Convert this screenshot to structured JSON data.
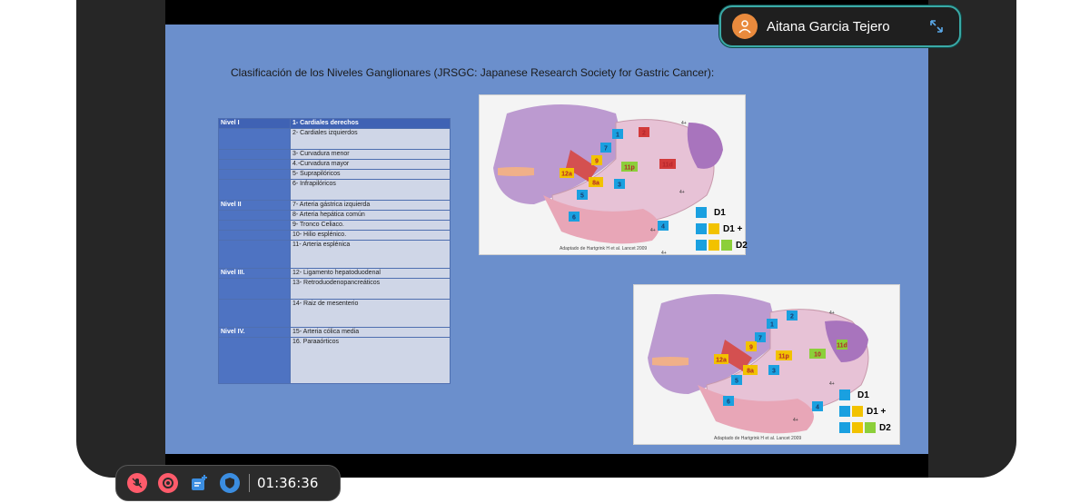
{
  "participant": {
    "name": "Aitana Garcia Tejero"
  },
  "toolbar": {
    "timer": "01:36:36"
  },
  "slide": {
    "title": "Clasificación de los Niveles Ganglionares (JRSGC: Japanese Research Society for Gastric Cancer):",
    "table": [
      {
        "level": "Nivel I",
        "desc": "1- Cardiales derechos",
        "header": true
      },
      {
        "level": "",
        "desc": "2- Cardiales izquierdos",
        "tall": true
      },
      {
        "level": "",
        "desc": "3- Curvadura menor"
      },
      {
        "level": "",
        "desc": "4.-Curvadura mayor"
      },
      {
        "level": "",
        "desc": "5- Suprapilóricos"
      },
      {
        "level": "",
        "desc": "6- Infrapilóricos",
        "tall": true
      },
      {
        "level": "Nivel II",
        "desc": "7- Arteria gástrica izquierda"
      },
      {
        "level": "",
        "desc": "8- Arteria hepática común"
      },
      {
        "level": "",
        "desc": "9- Tronco Celiaco."
      },
      {
        "level": "",
        "desc": "10- Hilio esplénico."
      },
      {
        "level": "",
        "desc": "11- Arteria esplénica",
        "tall2": true
      },
      {
        "level": "Nivel III.",
        "desc": "12- Ligamento hepatoduodenal"
      },
      {
        "level": "",
        "desc": "13- Retroduodenopancreáticos",
        "tall": true
      },
      {
        "level": "",
        "desc": "14- Raiz de mesenterio",
        "tall2": true
      },
      {
        "level": "Nivel IV.",
        "desc": "15- Arteria cólica media"
      },
      {
        "level": "",
        "desc": "16. Paraaórticos",
        "tall3": true
      }
    ],
    "figure1": {
      "credit": "Adaptado de Hartgrink H et al. Lancet 2009",
      "legend": [
        "D1",
        "D1 +",
        "D2"
      ],
      "nodes": [
        "1",
        "2",
        "3",
        "4",
        "5",
        "6",
        "7",
        "8a",
        "9",
        "11d",
        "11p",
        "12a",
        "4+",
        "4+",
        "4+",
        "4+"
      ]
    },
    "figure2": {
      "credit": "Adaptado de Hartgrink H et al. Lancet 2009",
      "legend": [
        "D1",
        "D1 +",
        "D2"
      ],
      "nodes": [
        "1",
        "2",
        "3",
        "4",
        "5",
        "6",
        "7",
        "8a",
        "9",
        "10",
        "11d",
        "11p",
        "12a",
        "4+",
        "4+",
        "4+"
      ]
    },
    "colors": {
      "blue": "#1aa0e0",
      "yellow": "#f2c200",
      "green": "#8ccf3a",
      "red": "#d23a3a"
    }
  },
  "icons": [
    "person-icon",
    "expand-icon",
    "mic-off-icon",
    "record-icon",
    "note-add-icon",
    "shield-icon"
  ]
}
